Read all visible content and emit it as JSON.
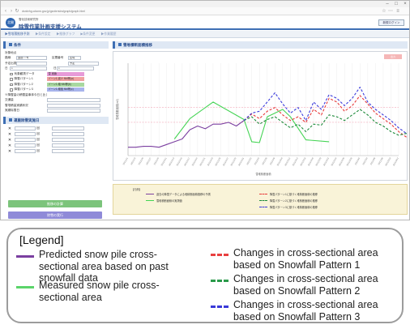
{
  "browser": {
    "url": "dsnbrhg.cdsnm.gov.jp/gsnbrrsbn/graph/graph.html",
    "back_icon": "back-arrow-icon",
    "forward_icon": "forward-arrow-icon",
    "reload_icon": "reload-icon",
    "minimize": "–",
    "maximize": "□",
    "close": "×"
  },
  "app": {
    "logo_text": "北開",
    "subtitle": "雪化技術研究所",
    "title": "除雪作業計画支援システム",
    "user_button": "新規ログイン"
  },
  "breadcrumb": [
    "▶雪堆積推移予測",
    "▶条件設定",
    "▶推移グラフ",
    "▶条件変更",
    "▶作業履歴"
  ],
  "left_panel": {
    "conditions_title": "条件",
    "rows": [
      {
        "label": "対象地点",
        "value": ""
      },
      {
        "label": "路線",
        "value": "国道○○号",
        "label2": "区間番号",
        "value2": "区域"
      },
      {
        "label": "予定出発",
        "value": "",
        "label2": "",
        "value2": "予定"
      },
      {
        "label": "日",
        "value": "1",
        "label2": "日",
        "value2": "1"
      }
    ],
    "series_rows": [
      {
        "label": "気象観測データ",
        "swatch": "雪 実績",
        "color": "#e79ad8"
      },
      {
        "label": "降雪パターン1",
        "swatch": "ゾーン1 減少 NM等(a)",
        "color": "#f0a0a0"
      },
      {
        "label": "降雪パターン2",
        "swatch": "ゾーン1 増 NM等(b)",
        "color": "#a8d8a0"
      },
      {
        "label": "降雪パターン3",
        "swatch": "ゾーン1 増強 NM等(c)",
        "color": "#a8b4ec"
      }
    ],
    "extra_rows": [
      "※降雪量の積雪量事体今日と比して(単位:cm)",
      "交通量",
      "雪堆積量実績状況",
      "実績除雪日"
    ],
    "removal_title": "運搬除雪実施日",
    "removal_rows": [
      "1",
      "2",
      "3",
      "4",
      "5"
    ],
    "removal_unit": "回",
    "btn_calc": "推移の計算",
    "btn_run": "除雪の実行"
  },
  "right_panel": {
    "chart_title": "雪堆積断面積推移",
    "export_button": "出力"
  },
  "chart_data": {
    "type": "line",
    "ylim": [
      0,
      100
    ],
    "x_count": 36,
    "x_tick_labels": [
      "2021/1/1",
      "2021/1/3",
      "2021/1/5",
      "2021/1/7",
      "2021/1/9",
      "2021/1/11",
      "2021/1/13",
      "2021/1/15",
      "2021/1/17",
      "2021/1/19",
      "2021/1/21",
      "2021/1/23",
      "2021/1/25",
      "2021/1/27",
      "2021/1/29",
      "2021/1/31",
      "2021/2/2",
      "2021/2/4",
      "2021/2/6",
      "2021/2/8",
      "2021/2/10",
      "2021/2/12",
      "2021/2/14",
      "2021/2/16",
      "2021/2/18",
      "2021/2/20",
      "2021/2/22",
      "2021/2/24",
      "2021/2/26",
      "2021/2/28",
      "2021/3/2",
      "2021/3/4",
      "2021/3/6",
      "2021/3/8",
      "2021/3/10",
      "2021/3/12"
    ],
    "xlabel": "雪堆積断面積",
    "ylabel": "雪堆積断面積(m2)",
    "threshold_values": [
      52,
      36
    ],
    "series": [
      {
        "name": "過去の降雪データによる堆積断面積推移の予測",
        "color": "#7b3fa0",
        "dash": "",
        "start": 0,
        "values": [
          9,
          9,
          10,
          10,
          9,
          12,
          15,
          18,
          28,
          32,
          29,
          34,
          34,
          36,
          32,
          38
        ]
      },
      {
        "name": "雪堆積断面積の実測値",
        "color": "#44d454",
        "dash": "",
        "start": 6,
        "values": [
          18,
          null,
          40,
          null,
          null,
          58,
          null,
          null,
          null,
          39,
          15,
          14,
          42,
          null,
          50,
          42,
          null,
          17,
          null,
          null,
          15
        ]
      },
      {
        "name": "降雪パターン1に基づく堆積断面積の推移",
        "color": "#e83a3a",
        "dash": "3,2",
        "start": 15,
        "values": [
          38,
          45,
          40,
          48,
          52,
          44,
          38,
          42,
          36,
          50,
          44,
          62,
          58,
          48,
          54,
          65,
          56,
          46,
          40,
          34,
          26,
          20,
          6,
          -6
        ]
      },
      {
        "name": "降雪パターン2に基づく堆積断面積の推移",
        "color": "#1d8a3a",
        "dash": "3,2",
        "start": 15,
        "values": [
          38,
          42,
          34,
          39,
          42,
          36,
          30,
          34,
          26,
          34,
          33,
          44,
          42,
          38,
          44,
          50,
          44,
          36,
          32,
          26,
          22,
          24,
          14,
          4
        ]
      },
      {
        "name": "降雪パターン3に基づく堆積断面積の推移",
        "color": "#3b3bdc",
        "dash": "3,2",
        "start": 15,
        "values": [
          38,
          46,
          48,
          58,
          68,
          56,
          46,
          52,
          38,
          58,
          50,
          66,
          62,
          54,
          62,
          74,
          58,
          50,
          44,
          38,
          30,
          24,
          12,
          2
        ]
      }
    ]
  },
  "mini_legend": {
    "title": "【凡例】",
    "items": [
      "過去の降雪データによる堆積断面積推移の予測",
      "雪堆積断面積の実測値",
      "降雪パターン1に基づく堆積断面積の推移",
      "降雪パターン2に基づく堆積断面積の推移",
      "降雪パターン3に基づく堆積断面積の推移"
    ]
  },
  "legend": {
    "title": "[Legend]",
    "items": [
      {
        "text": "Predicted snow pile cross-sectional area based on past snowfall data",
        "color": "#7b3fa0",
        "dash": false
      },
      {
        "text": "Measured snow pile cross-sectional area",
        "color": "#5bd46a",
        "dash": false
      },
      {
        "text": "Changes in cross-sectional area based on Snowfall Pattern 1",
        "color": "#e84040",
        "dash": true
      },
      {
        "text": "Changes in cross-sectional area based on Snowfall Pattern 2",
        "color": "#2a9a4a",
        "dash": true
      },
      {
        "text": "Changes in cross-sectional area based on Snowfall Pattern 3",
        "color": "#3a3ad8",
        "dash": true
      }
    ]
  }
}
